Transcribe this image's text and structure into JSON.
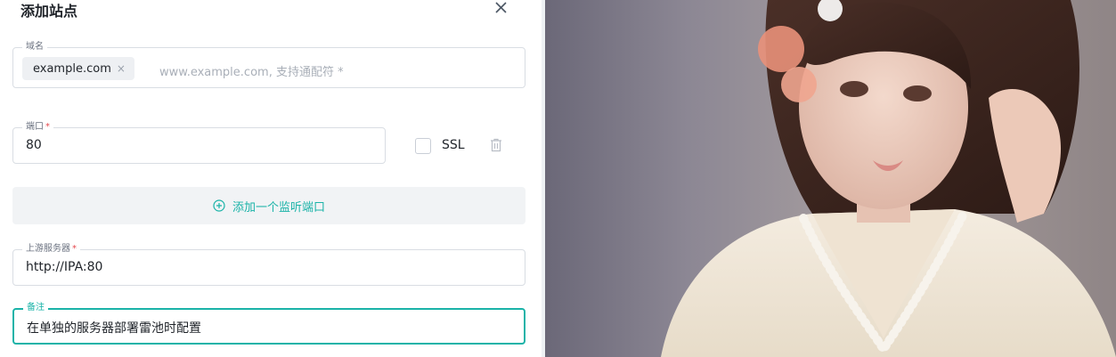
{
  "dialog": {
    "title": "添加站点",
    "domain_field": {
      "label": "域名",
      "chip": "example.com",
      "chip_remove": "×",
      "placeholder": "www.example.com, 支持通配符 *"
    },
    "port_field": {
      "label": "端口",
      "required_mark": "*",
      "value": "80"
    },
    "ssl_label": "SSL",
    "add_port_label": "添加一个监听端口",
    "upstream_field": {
      "label": "上游服务器",
      "required_mark": "*",
      "value": "http://IPA:80"
    },
    "remark_field": {
      "label": "备注",
      "value": "在单独的服务器部署雷池时配置"
    }
  },
  "colors": {
    "accent": "#1ab3a8",
    "required": "#e5484d"
  },
  "icons": [
    "close-icon",
    "trash-icon",
    "plus-circle-icon"
  ]
}
